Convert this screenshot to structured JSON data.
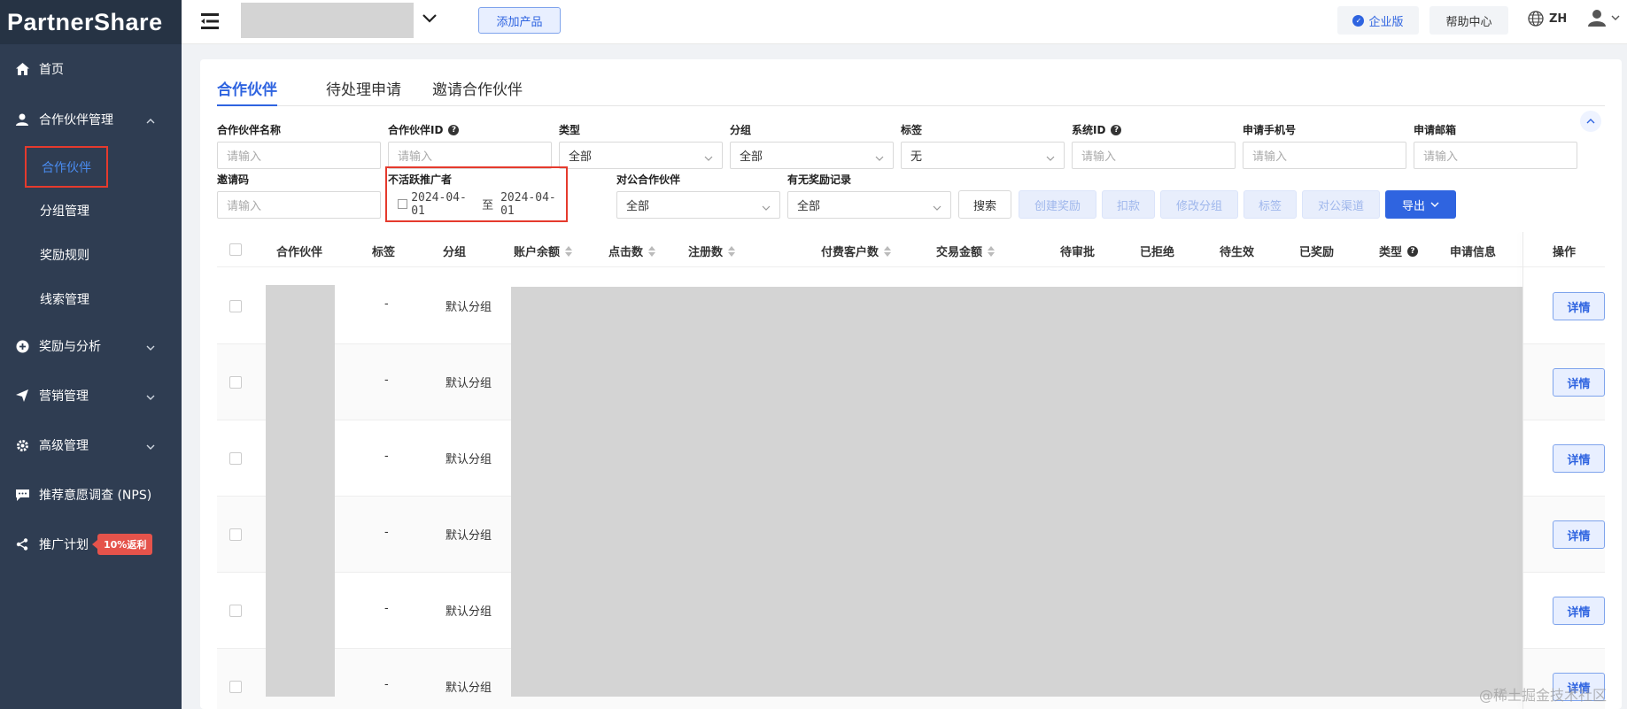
{
  "brand": {
    "logo_text": "PartnerShare"
  },
  "sidebar": {
    "home": "首页",
    "partner_mgmt": "合作伙伴管理",
    "sub_partners": "合作伙伴",
    "sub_groups": "分组管理",
    "sub_rewards": "奖励规则",
    "sub_leads": "线索管理",
    "rewards_analysis": "奖励与分析",
    "marketing": "营销管理",
    "advanced": "高级管理",
    "nps": "推荐意愿调查 (NPS)",
    "promo_plan": "推广计划",
    "promo_badge": "10%返利"
  },
  "topbar": {
    "add_product": "添加产品",
    "enterprise": "企业版",
    "help_center": "帮助中心",
    "language": "ZH"
  },
  "tabs": [
    "合作伙伴",
    "待处理申请",
    "邀请合作伙伴"
  ],
  "filters": {
    "partner_name": {
      "label": "合作伙伴名称",
      "placeholder": "请输入"
    },
    "partner_id": {
      "label": "合作伙伴ID",
      "placeholder": "请输入"
    },
    "type": {
      "label": "类型",
      "value": "全部"
    },
    "group": {
      "label": "分组",
      "value": "全部"
    },
    "tag": {
      "label": "标签",
      "value": "无"
    },
    "system_id": {
      "label": "系统ID",
      "placeholder": "请输入"
    },
    "phone": {
      "label": "申请手机号",
      "placeholder": "请输入"
    },
    "email": {
      "label": "申请邮箱",
      "placeholder": "请输入"
    },
    "invite_code": {
      "label": "邀请码",
      "placeholder": "请输入"
    },
    "inactive": {
      "label": "不活跃推广者",
      "start": "2024-04-01",
      "separator": "至",
      "end": "2024-04-01"
    },
    "b2b_partner": {
      "label": "对公合作伙伴",
      "value": "全部"
    },
    "has_reward": {
      "label": "有无奖励记录",
      "value": "全部"
    }
  },
  "actions": {
    "search": "搜索",
    "create_reward": "创建奖励",
    "deduct": "扣款",
    "modify_group": "修改分组",
    "tag": "标签",
    "b2b_channel": "对公渠道",
    "export": "导出"
  },
  "table": {
    "columns": [
      "合作伙伴",
      "标签",
      "分组",
      "账户余额",
      "点击数",
      "注册数",
      "付费客户数",
      "交易金额",
      "待审批",
      "已拒绝",
      "待生效",
      "已奖励",
      "类型",
      "申请信息",
      "操作"
    ],
    "rows": [
      {
        "tag": "-",
        "group": "默认分组",
        "action": "详情"
      },
      {
        "tag": "-",
        "group": "默认分组",
        "action": "详情"
      },
      {
        "tag": "-",
        "group": "默认分组",
        "action": "详情"
      },
      {
        "tag": "-",
        "group": "默认分组",
        "action": "详情"
      },
      {
        "tag": "-",
        "group": "默认分组",
        "action": "详情"
      },
      {
        "tag": "-",
        "group": "默认分组",
        "action": "详情"
      }
    ]
  },
  "watermark": "@稀土掘金技术社区",
  "colors": {
    "primary": "#2f64e0",
    "sidebar": "#2f3d52",
    "highlight": "#e53a2d"
  }
}
